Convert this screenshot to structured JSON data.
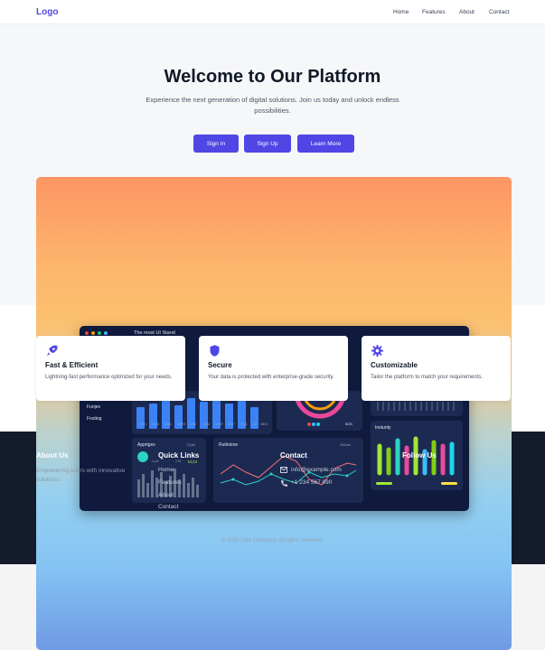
{
  "nav": {
    "logo": "Logo",
    "links": [
      "Home",
      "Features",
      "About",
      "Contact"
    ]
  },
  "hero": {
    "title": "Welcome to Our Platform",
    "subtitle": "Experience the next generation of digital solutions. Join us today and unlock endless possibilities.",
    "buttons": [
      "Sign In",
      "Sign Up",
      "Learn More"
    ]
  },
  "dashboard": {
    "header_text": "The most UI Stand",
    "sidebar": [
      "Funjes",
      "Fosting"
    ],
    "panels": [
      "Appriges",
      "Rutinione",
      "Insturity"
    ],
    "axis_labels": [
      "1Y21",
      "1025",
      "2021",
      "1ME9",
      "12M",
      "1203",
      "1YEF",
      "2027",
      "2021",
      "22",
      "1819"
    ],
    "small_text": [
      "7Q48",
      "1.col",
      "1Y5",
      "€123",
      "100ms",
      "5/23"
    ]
  },
  "features": [
    {
      "icon": "rocket-icon",
      "title": "Fast & Efficient",
      "desc": "Lightning-fast performance optimized for your needs."
    },
    {
      "icon": "shield-icon",
      "title": "Secure",
      "desc": "Your data is protected with enterprise-grade security."
    },
    {
      "icon": "gear-icon",
      "title": "Customizable",
      "desc": "Tailor the platform to match your requirements."
    }
  ],
  "footer": {
    "about_title": "About Us",
    "about_text": "Empowering users with innovative solutions.",
    "quick_links_title": "Quick Links",
    "quick_links": [
      "Home",
      "Features",
      "About",
      "Contact"
    ],
    "contact_title": "Contact",
    "email": "info@example.com",
    "phone": "+1 234 567 890",
    "follow_title": "Follow Us",
    "copyright": "© 2025 Your Company. All rights reserved."
  },
  "colors": {
    "accent": "#4f46e5",
    "footer_bg": "#141c2c"
  }
}
